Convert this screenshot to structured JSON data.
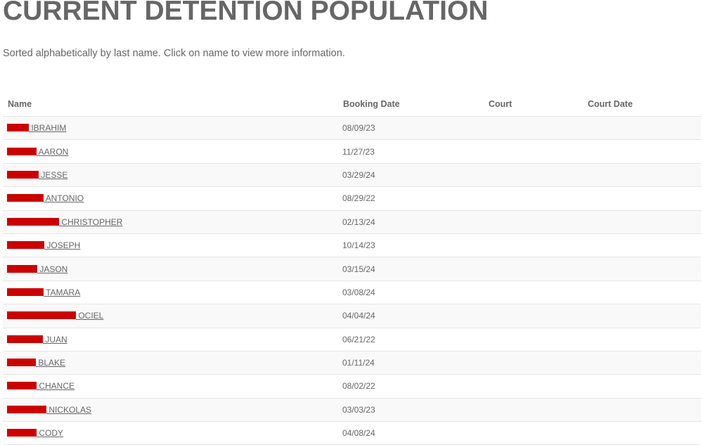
{
  "page": {
    "title": "CURRENT DETENTION POPULATION",
    "subtitle": "Sorted alphabetically by last name. Click on name to view more information."
  },
  "colors": {
    "text": "#666666",
    "redaction": "#cc0000",
    "row_alt": "#f9f9f9",
    "border": "#e6e6e6"
  },
  "table": {
    "headers": [
      "Name",
      "Booking Date",
      "Court",
      "Court Date"
    ],
    "rows": [
      {
        "name": " IBRAHIM",
        "redacted": true,
        "booking_date": "08/09/23",
        "court": "",
        "court_date": ""
      },
      {
        "name": " AARON",
        "redacted": true,
        "booking_date": "11/27/23",
        "court": "",
        "court_date": ""
      },
      {
        "name": " JESSE",
        "redacted": true,
        "booking_date": "03/29/24",
        "court": "",
        "court_date": ""
      },
      {
        "name": " ANTONIO",
        "redacted": true,
        "booking_date": "08/29/22",
        "court": "",
        "court_date": ""
      },
      {
        "name": " CHRISTOPHER",
        "redacted": true,
        "booking_date": "02/13/24",
        "court": "",
        "court_date": ""
      },
      {
        "name": " JOSEPH",
        "redacted": true,
        "booking_date": "10/14/23",
        "court": "",
        "court_date": ""
      },
      {
        "name": " JASON",
        "redacted": true,
        "booking_date": "03/15/24",
        "court": "",
        "court_date": ""
      },
      {
        "name": " TAMARA",
        "redacted": true,
        "booking_date": "03/08/24",
        "court": "",
        "court_date": ""
      },
      {
        "name": " OCIEL",
        "redacted": true,
        "booking_date": "04/04/24",
        "court": "",
        "court_date": ""
      },
      {
        "name": " JUAN",
        "redacted": true,
        "booking_date": "06/21/22",
        "court": "",
        "court_date": ""
      },
      {
        "name": " BLAKE",
        "redacted": true,
        "booking_date": "01/11/24",
        "court": "",
        "court_date": ""
      },
      {
        "name": " CHANCE",
        "redacted": true,
        "booking_date": "08/02/22",
        "court": "",
        "court_date": ""
      },
      {
        "name": " NICKOLAS",
        "redacted": true,
        "booking_date": "03/03/23",
        "court": "",
        "court_date": ""
      },
      {
        "name": " CODY",
        "redacted": true,
        "booking_date": "04/08/24",
        "court": "",
        "court_date": ""
      }
    ]
  }
}
